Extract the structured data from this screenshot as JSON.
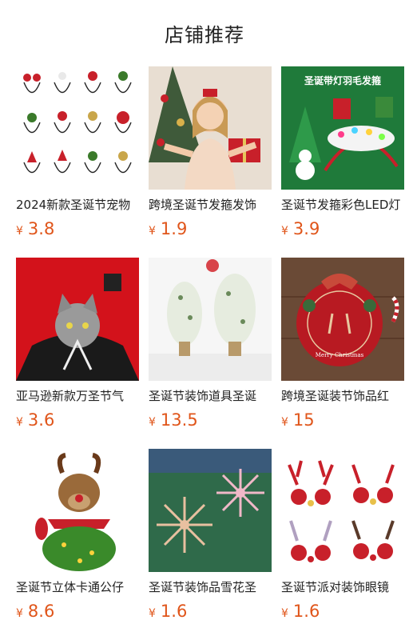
{
  "header": {
    "title": "店铺推荐"
  },
  "colors": {
    "price": "#e0551a",
    "bg": "#ffffff",
    "text": "#222222"
  },
  "products": [
    {
      "name": "2024新款圣诞节宠物",
      "currency": "¥",
      "price": "3.8",
      "image": "pet-headband-set"
    },
    {
      "name": "跨境圣诞节发箍发饰",
      "currency": "¥",
      "price": "1.9",
      "image": "girl-christmas-tree"
    },
    {
      "name": "圣诞节发箍彩色LED灯",
      "currency": "¥",
      "price": "3.9",
      "image": "led-feather-headband",
      "image_caption": "圣诞带灯羽毛发箍"
    },
    {
      "name": "亚马逊新款万圣节气",
      "currency": "¥",
      "price": "3.6",
      "image": "cat-bat-costume"
    },
    {
      "name": "圣诞节装饰道具圣诞",
      "currency": "¥",
      "price": "13.5",
      "image": "mini-white-trees"
    },
    {
      "name": "跨境圣诞装节饰品红",
      "currency": "¥",
      "price": "15",
      "image": "wreath-sign",
      "image_caption": "Merry Christmas"
    },
    {
      "name": "圣诞节立体卡通公仔",
      "currency": "¥",
      "price": "8.6",
      "image": "plush-reindeer"
    },
    {
      "name": "圣诞节装饰品雪花圣",
      "currency": "¥",
      "price": "1.6",
      "image": "glitter-snowflakes"
    },
    {
      "name": "圣诞节派对装饰眼镜",
      "currency": "¥",
      "price": "1.6",
      "image": "antler-glasses"
    }
  ]
}
